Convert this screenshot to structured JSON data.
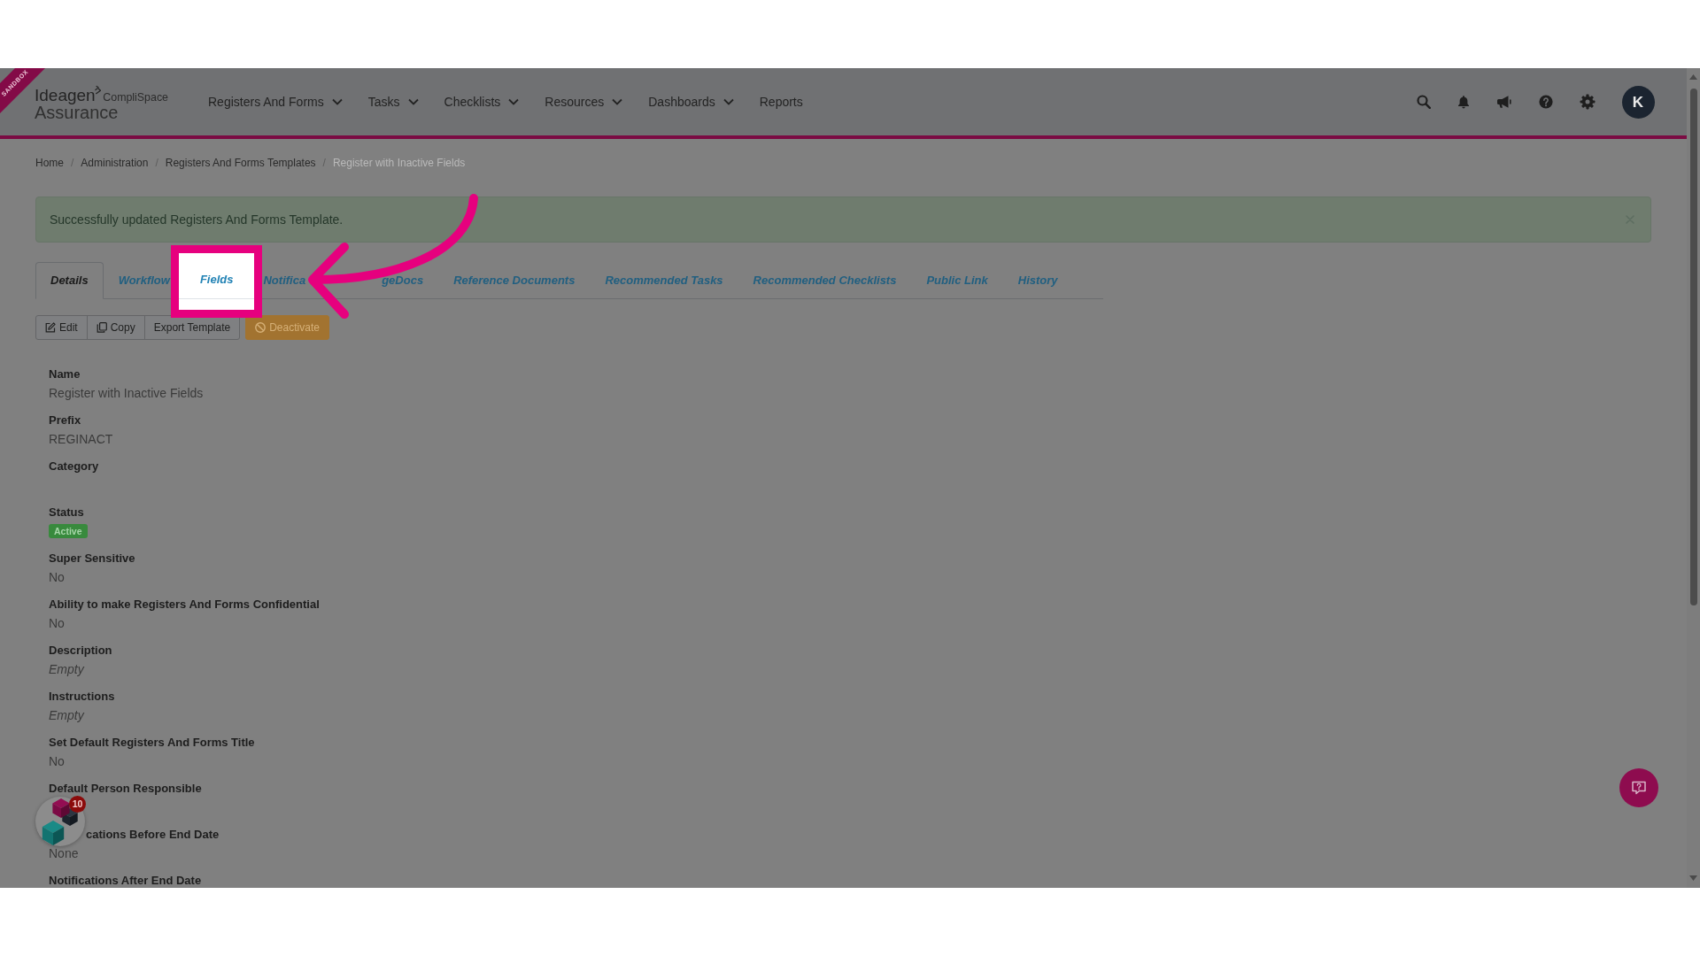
{
  "header": {
    "ribbon": "SANDBOX",
    "logo": {
      "brand": "Ideagen",
      "product": "CompliSpace",
      "subtitle": "Assurance"
    },
    "menu": [
      {
        "label": "Registers And Forms",
        "dropdown": true
      },
      {
        "label": "Tasks",
        "dropdown": true
      },
      {
        "label": "Checklists",
        "dropdown": true
      },
      {
        "label": "Resources",
        "dropdown": true
      },
      {
        "label": "Dashboards",
        "dropdown": true
      },
      {
        "label": "Reports",
        "dropdown": false
      }
    ],
    "avatar": "K"
  },
  "breadcrumb": [
    {
      "label": "Home",
      "current": false,
      "separator": "/"
    },
    {
      "label": "Administration",
      "current": false,
      "separator": "/"
    },
    {
      "label": "Registers And Forms Templates",
      "current": false,
      "separator": "/"
    },
    {
      "label": "Register with Inactive Fields",
      "current": true
    }
  ],
  "alert": {
    "message": "Successfully updated Registers And Forms Template."
  },
  "tabs": [
    {
      "label": "Details",
      "selected": true,
      "highlighted": false,
      "kind": "whole"
    },
    {
      "label": "Workflow",
      "selected": false,
      "highlighted": false,
      "kind": "whole"
    },
    {
      "label": "Fields",
      "selected": false,
      "highlighted": true,
      "kind": "whole"
    },
    {
      "label": "Notifica",
      "selected": false,
      "highlighted": false,
      "kind": "cut_end"
    },
    {
      "label": "geDocs",
      "selected": false,
      "highlighted": false,
      "kind": "cut_start"
    },
    {
      "label": "Reference Documents",
      "selected": false,
      "highlighted": false,
      "kind": "whole"
    },
    {
      "label": "Recommended Tasks",
      "selected": false,
      "highlighted": false,
      "kind": "whole"
    },
    {
      "label": "Recommended Checklists",
      "selected": false,
      "highlighted": false,
      "kind": "whole"
    },
    {
      "label": "Public Link",
      "selected": false,
      "highlighted": false,
      "kind": "whole"
    },
    {
      "label": "History",
      "selected": false,
      "highlighted": false,
      "kind": "whole"
    }
  ],
  "actions": [
    {
      "label": "Edit",
      "kind": "edit"
    },
    {
      "label": "Copy",
      "kind": "copy"
    },
    {
      "label": "Export Template",
      "kind": "export"
    },
    {
      "label": "Deactivate",
      "kind": "deactivate"
    }
  ],
  "fields": [
    {
      "label": "Name",
      "kind": "text",
      "value": "Register with Inactive Fields"
    },
    {
      "label": "Prefix",
      "kind": "text",
      "value": "REGINACT"
    },
    {
      "label": "Category",
      "kind": "blank"
    },
    {
      "label": "Status",
      "kind": "badge",
      "value": "Active"
    },
    {
      "label": "Super Sensitive",
      "kind": "text",
      "value": "No"
    },
    {
      "label": "Ability to make Registers And Forms Confidential",
      "kind": "text",
      "value": "No"
    },
    {
      "label": "Description",
      "kind": "italic",
      "value": "Empty"
    },
    {
      "label": "Instructions",
      "kind": "italic",
      "value": "Empty"
    },
    {
      "label": "Set Default Registers And Forms Title",
      "kind": "text",
      "value": "No"
    },
    {
      "label": "Default Person Responsible",
      "kind": "blank"
    },
    {
      "label": "cations Before End Date",
      "kind": "covered",
      "value": "None"
    },
    {
      "label": "Notifications After End Date",
      "kind": "blank"
    }
  ],
  "launcher": {
    "badge": "10"
  }
}
